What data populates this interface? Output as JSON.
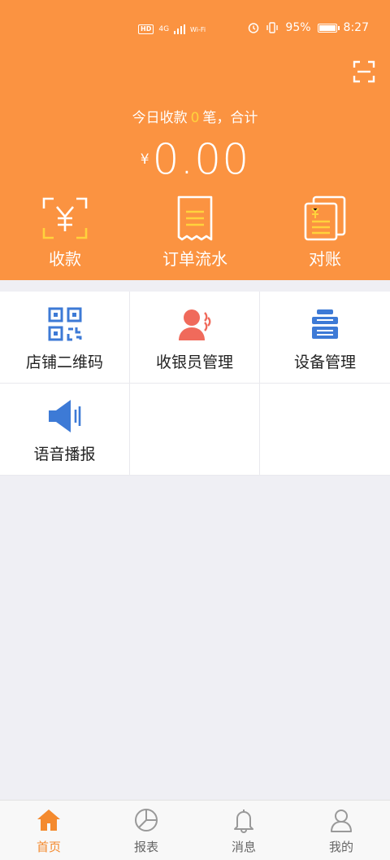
{
  "status_bar": {
    "network_tags": [
      "HD",
      "4G",
      "Wi-Fi"
    ],
    "battery": "95%",
    "time": "8:27"
  },
  "header": {
    "today_prefix": "今日收款",
    "today_count": "0",
    "today_suffix": "笔，合计",
    "currency_symbol": "¥",
    "amount": "0.00",
    "scan_icon": "scan-icon"
  },
  "quick_actions": [
    {
      "label": "收款",
      "icon": "yen-scan-icon"
    },
    {
      "label": "订单流水",
      "icon": "receipt-icon"
    },
    {
      "label": "对账",
      "icon": "ledger-icon"
    }
  ],
  "grid": [
    {
      "label": "店铺二维码",
      "icon": "qrcode-icon",
      "color": "#3d7ad6"
    },
    {
      "label": "收银员管理",
      "icon": "cashier-icon",
      "color": "#f06a5b"
    },
    {
      "label": "设备管理",
      "icon": "device-icon",
      "color": "#3d7ad6"
    },
    {
      "label": "语音播报",
      "icon": "speaker-icon",
      "color": "#3d7ad6"
    }
  ],
  "tabs": [
    {
      "label": "首页",
      "icon": "home-icon",
      "active": true
    },
    {
      "label": "报表",
      "icon": "pie-chart-icon",
      "active": false
    },
    {
      "label": "消息",
      "icon": "bell-icon",
      "active": false
    },
    {
      "label": "我的",
      "icon": "user-icon",
      "active": false
    }
  ],
  "colors": {
    "primary": "#fb9341",
    "highlight": "#ffd23c",
    "tab_active": "#f48a2e",
    "background": "#efeff4"
  }
}
